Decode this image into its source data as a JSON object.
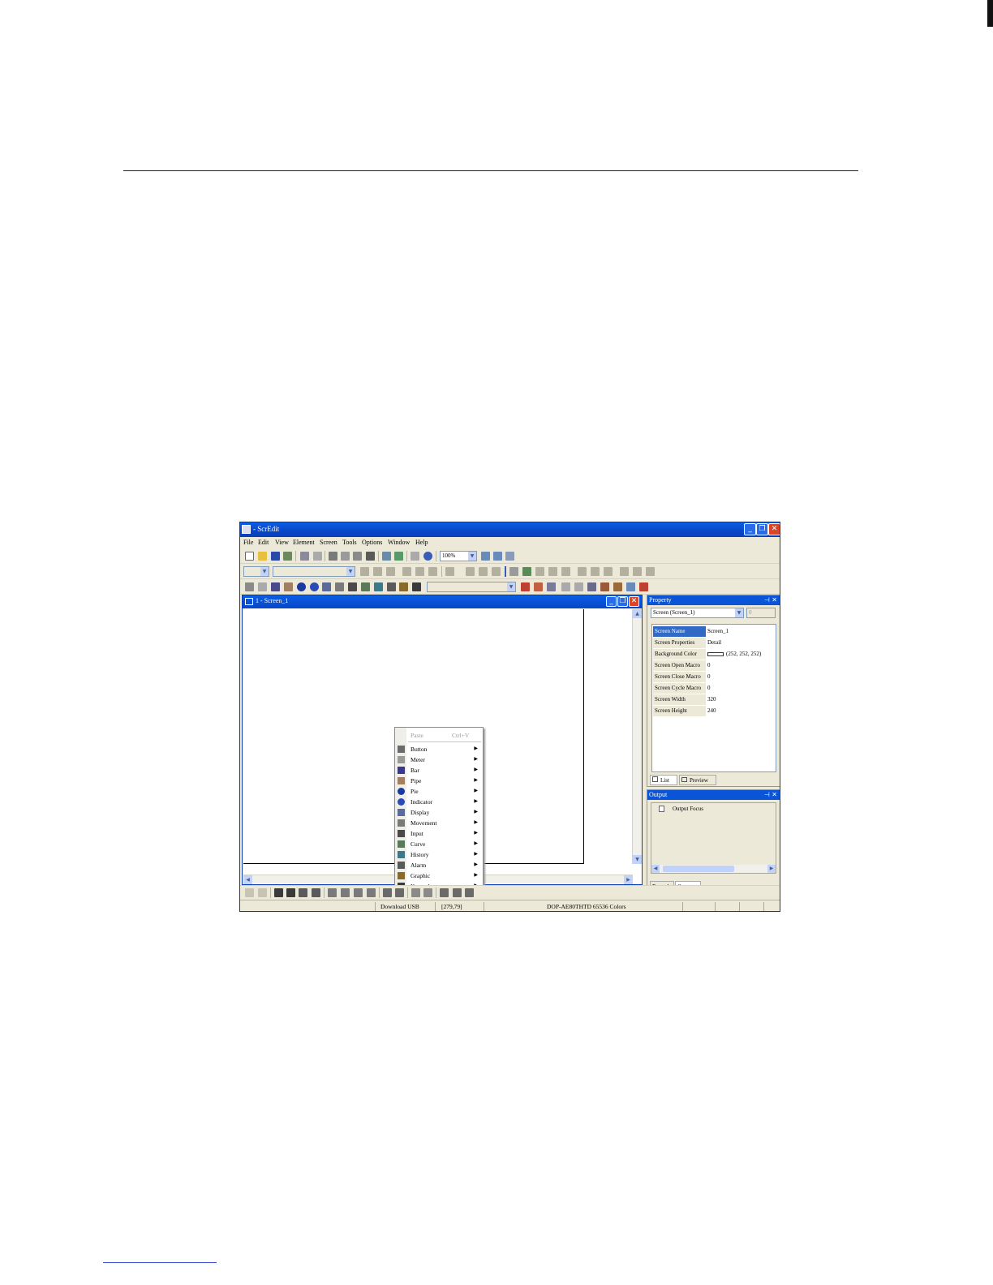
{
  "window": {
    "title": "- ScrEdit"
  },
  "menu": [
    "File",
    "Edit",
    "View",
    "Element",
    "Screen",
    "Tools",
    "Options",
    "Window",
    "Help"
  ],
  "toolbar": {
    "zoom_value": "100%"
  },
  "child_window": {
    "title": "1 - Screen_1"
  },
  "context_menu": {
    "paste_label": "Paste",
    "paste_shortcut": "Ctrl+V",
    "items": [
      {
        "label": "Button",
        "icon": "button-icon",
        "color": "#6b6b6b"
      },
      {
        "label": "Meter",
        "icon": "meter-icon",
        "color": "#9a9a9a"
      },
      {
        "label": "Bar",
        "icon": "bar-icon",
        "color": "#3a3a8a"
      },
      {
        "label": "Pipe",
        "icon": "pipe-icon",
        "color": "#a08060"
      },
      {
        "label": "Pie",
        "icon": "pie-icon",
        "color": "#1a3aa0"
      },
      {
        "label": "Indicator",
        "icon": "indicator-icon",
        "color": "#2a4ab8"
      },
      {
        "label": "Display",
        "icon": "display-icon",
        "color": "#5a6a9a"
      },
      {
        "label": "Movement",
        "icon": "movement-icon",
        "color": "#7a7a7a"
      },
      {
        "label": "Input",
        "icon": "input-icon",
        "color": "#4a4a4a"
      },
      {
        "label": "Curve",
        "icon": "curve-icon",
        "color": "#5a7a5a"
      },
      {
        "label": "History",
        "icon": "history-icon",
        "color": "#3a7a8a"
      },
      {
        "label": "Alarm",
        "icon": "alarm-icon",
        "color": "#5a5a5a"
      },
      {
        "label": "Graphic",
        "icon": "graphic-icon",
        "color": "#8a6a2a"
      },
      {
        "label": "Keypad",
        "icon": "keypad-icon",
        "color": "#3a3a3a"
      }
    ]
  },
  "property_panel": {
    "title": "Property",
    "selector_value": "Screen (Screen_1)",
    "selector_number": "0",
    "rows": [
      {
        "key": "Screen Name",
        "value": "Screen_1"
      },
      {
        "key": "Screen Properties",
        "value": "Detail"
      },
      {
        "key": "Background Color",
        "value": "(252, 252, 252)"
      },
      {
        "key": "Screen Open Macro",
        "value": "0"
      },
      {
        "key": "Screen Close Macro",
        "value": "0"
      },
      {
        "key": "Screen Cycle Macro",
        "value": "0"
      },
      {
        "key": "Screen Width",
        "value": "320"
      },
      {
        "key": "Screen Height",
        "value": "240"
      }
    ],
    "tabs": [
      "List",
      "Preview"
    ]
  },
  "output_panel": {
    "title": "Output",
    "item": "Output Focus",
    "tabs": [
      "Record",
      "Output"
    ]
  },
  "statusbar": {
    "download": "Download USB",
    "coords": "[279,79]",
    "model": "DOP-AE80THTD 65536 Colors"
  }
}
